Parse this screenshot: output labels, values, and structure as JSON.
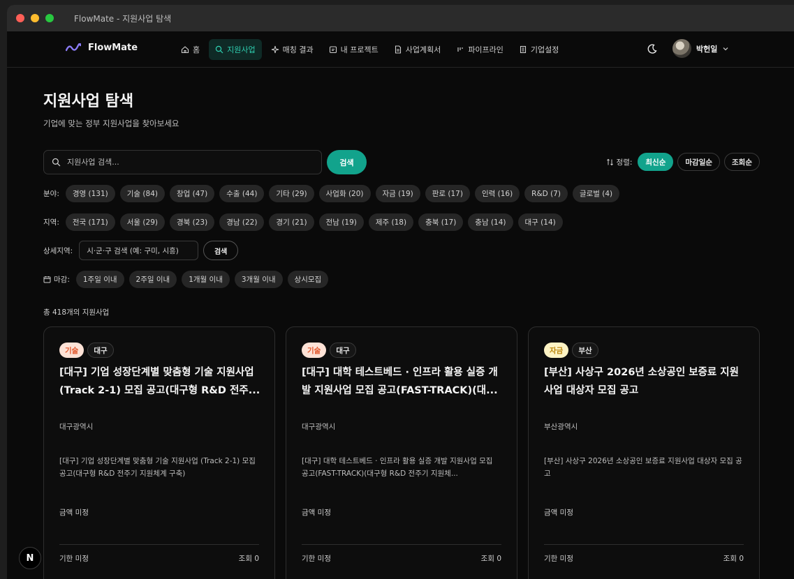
{
  "window": {
    "title": "FlowMate - 지원사업 탐색"
  },
  "nav": {
    "brand": "FlowMate",
    "items": [
      {
        "label": "홈",
        "icon": "home-icon"
      },
      {
        "label": "지원사업",
        "icon": "search-icon",
        "active": true
      },
      {
        "label": "매칭 결과",
        "icon": "sparkle-icon"
      },
      {
        "label": "내 프로젝트",
        "icon": "folder-icon"
      },
      {
        "label": "사업계획서",
        "icon": "document-icon"
      },
      {
        "label": "파이프라인",
        "icon": "pipeline-icon"
      },
      {
        "label": "기업설정",
        "icon": "building-icon"
      }
    ],
    "user_name": "박헌일",
    "accent": "#2fd1b2"
  },
  "page": {
    "title": "지원사업 탐색",
    "subtitle": "기업에 맞는 정부 지원사업을 찾아보세요"
  },
  "search": {
    "placeholder": "지원사업 검색...",
    "button": "검색"
  },
  "sort": {
    "label": "정렬:",
    "options": [
      "최신순",
      "마감일순",
      "조회순"
    ],
    "selected": "최신순"
  },
  "filters": {
    "category": {
      "label": "분야:",
      "chips": [
        "경영 (131)",
        "기술 (84)",
        "창업 (47)",
        "수출 (44)",
        "기타 (29)",
        "사업화 (20)",
        "자금 (19)",
        "판로 (17)",
        "인력 (16)",
        "R&D (7)",
        "글로벌 (4)"
      ]
    },
    "region": {
      "label": "지역:",
      "chips": [
        "전국 (171)",
        "서울 (29)",
        "경북 (23)",
        "경남 (22)",
        "경기 (21)",
        "전남 (19)",
        "제주 (18)",
        "충북 (17)",
        "충남 (14)",
        "대구 (14)"
      ]
    },
    "detail_region": {
      "label": "상세지역:",
      "placeholder": "시·군·구 검색 (예: 구미, 시흥)",
      "button": "검색"
    },
    "deadline": {
      "label": "마감:",
      "chips": [
        "1주일 이내",
        "2주일 이내",
        "1개월 이내",
        "3개월 이내",
        "상시모집"
      ]
    }
  },
  "total": "총 418개의 지원사업",
  "cards": [
    {
      "tag": "기술",
      "tag_type": "tech",
      "region_tag": "대구",
      "title": "[대구] 기업 성장단계별 맞춤형 기술 지원사업 (Track 2-1) 모집 공고(대구형 R&D 전주...",
      "region": "대구광역시",
      "desc": "[대구] 기업 성장단계별 맞춤형 기술 지원사업 (Track 2-1) 모집 공고(대구형 R&D 전주기 지원체계 구축)",
      "amount": "금액 미정",
      "deadline": "기한 미정",
      "views": "조회 0"
    },
    {
      "tag": "기술",
      "tag_type": "tech",
      "region_tag": "대구",
      "title": "[대구] 대학 테스트베드 · 인프라 활용 실증 개발 지원사업 모집 공고(FAST-TRACK)(대...",
      "region": "대구광역시",
      "desc": "[대구] 대학 테스트베드 · 인프라 활용 실증 개발 지원사업 모집 공고(FAST-TRACK)(대구형 R&D 전주기 지원체...",
      "amount": "금액 미정",
      "deadline": "기한 미정",
      "views": "조회 0"
    },
    {
      "tag": "자금",
      "tag_type": "fund",
      "region_tag": "부산",
      "title": "[부산] 사상구 2026년 소상공인 보증료 지원사업 대상자 모집 공고",
      "region": "부산광역시",
      "desc": "[부산] 사상구 2026년 소상공인 보증료 지원사업 대상자 모집 공고",
      "amount": "금액 미정",
      "deadline": "기한 미정",
      "views": "조회 0"
    }
  ],
  "badge": "N"
}
